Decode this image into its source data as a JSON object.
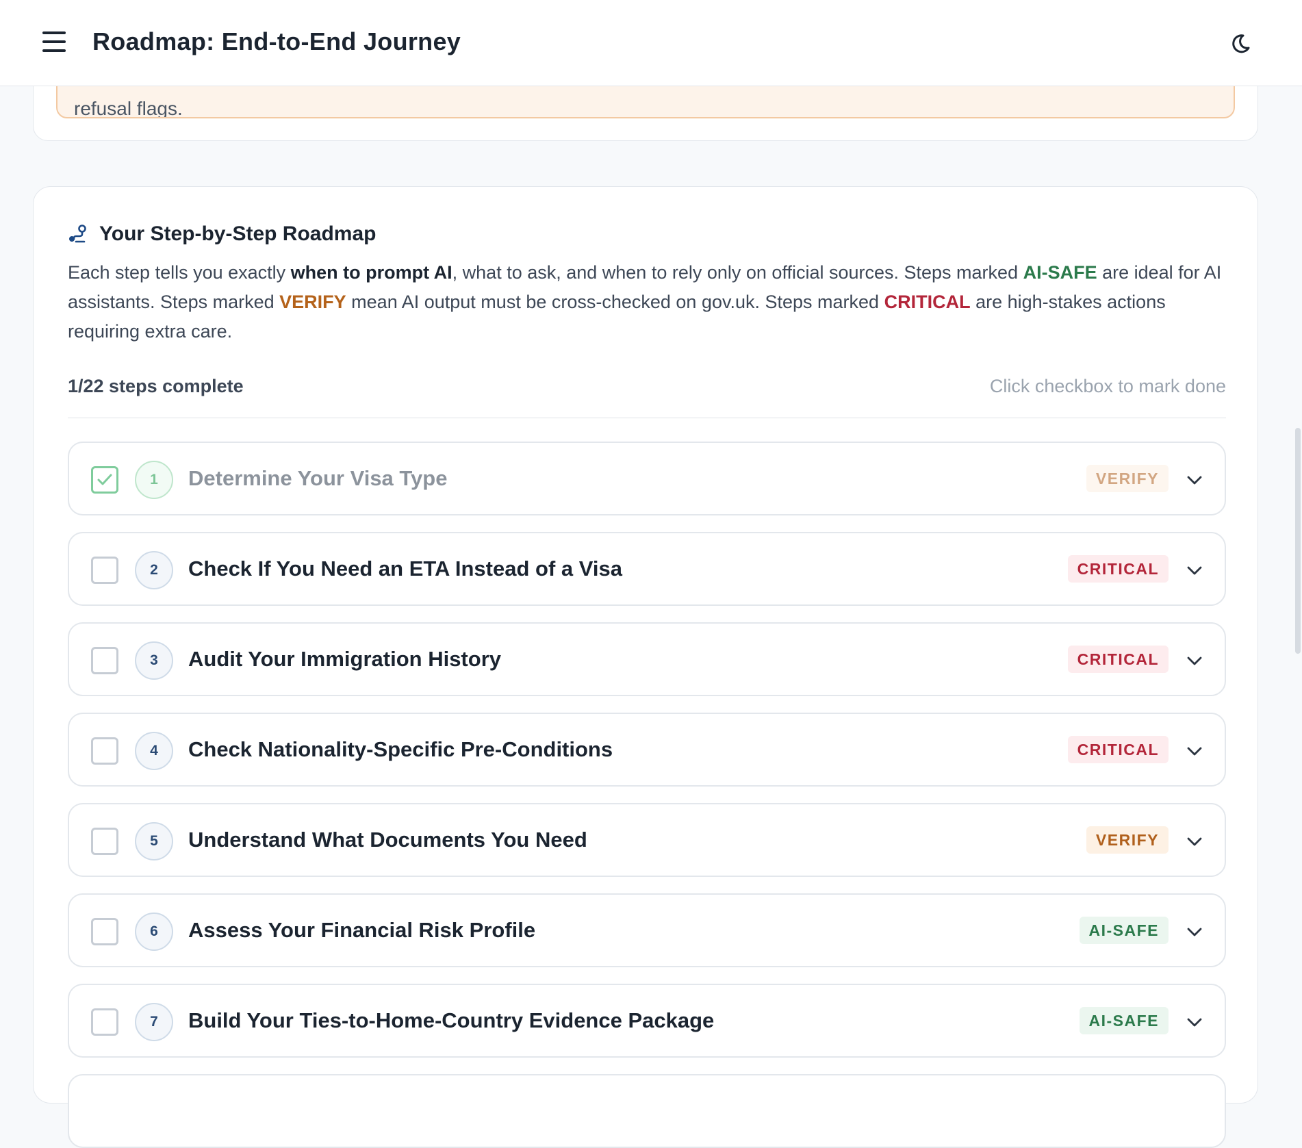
{
  "header": {
    "title": "Roadmap: End-to-End Journey"
  },
  "previous_card": {
    "note_fragment": "refusal flags."
  },
  "roadmap": {
    "title": "Your Step-by-Step Roadmap",
    "intro": {
      "p1": "Each step tells you exactly ",
      "b1": "when to prompt AI",
      "p2": ", what to ask, and when to rely only on official sources. Steps marked ",
      "kw_safe": "AI-SAFE",
      "p3": " are ideal for AI assistants. Steps marked ",
      "kw_verify": "VERIFY",
      "p4": " mean AI output must be cross-checked on gov.uk. Steps marked ",
      "kw_critical": "CRITICAL",
      "p5": " are high-stakes actions requiring extra care."
    },
    "progress_text": "1/22 steps complete",
    "progress_hint": "Click checkbox to mark done",
    "steps": [
      {
        "number": "1",
        "title": "Determine Your Visa Type",
        "badge": "VERIFY",
        "done": true
      },
      {
        "number": "2",
        "title": "Check If You Need an ETA Instead of a Visa",
        "badge": "CRITICAL",
        "done": false
      },
      {
        "number": "3",
        "title": "Audit Your Immigration History",
        "badge": "CRITICAL",
        "done": false
      },
      {
        "number": "4",
        "title": "Check Nationality-Specific Pre-Conditions",
        "badge": "CRITICAL",
        "done": false
      },
      {
        "number": "5",
        "title": "Understand What Documents You Need",
        "badge": "VERIFY",
        "done": false
      },
      {
        "number": "6",
        "title": "Assess Your Financial Risk Profile",
        "badge": "AI-SAFE",
        "done": false
      },
      {
        "number": "7",
        "title": "Build Your Ties-to-Home-Country Evidence Package",
        "badge": "AI-SAFE",
        "done": false
      }
    ]
  },
  "icons": {
    "menu": "menu-icon",
    "theme": "moon-icon",
    "section": "route-icon",
    "check": "check-icon",
    "expand": "chevron-down-icon"
  },
  "colors": {
    "ai_safe": "#2b7a4b",
    "verify": "#b4621a",
    "critical": "#b3263a",
    "navy": "#1d4a86"
  }
}
